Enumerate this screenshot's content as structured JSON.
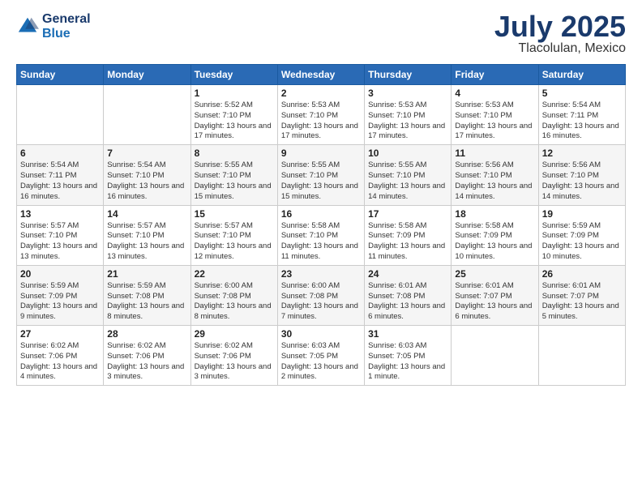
{
  "header": {
    "logo_general": "General",
    "logo_blue": "Blue",
    "month": "July 2025",
    "location": "Tlacolulan, Mexico"
  },
  "weekdays": [
    "Sunday",
    "Monday",
    "Tuesday",
    "Wednesday",
    "Thursday",
    "Friday",
    "Saturday"
  ],
  "weeks": [
    [
      {
        "day": "",
        "info": ""
      },
      {
        "day": "",
        "info": ""
      },
      {
        "day": "1",
        "info": "Sunrise: 5:52 AM\nSunset: 7:10 PM\nDaylight: 13 hours and 17 minutes."
      },
      {
        "day": "2",
        "info": "Sunrise: 5:53 AM\nSunset: 7:10 PM\nDaylight: 13 hours and 17 minutes."
      },
      {
        "day": "3",
        "info": "Sunrise: 5:53 AM\nSunset: 7:10 PM\nDaylight: 13 hours and 17 minutes."
      },
      {
        "day": "4",
        "info": "Sunrise: 5:53 AM\nSunset: 7:10 PM\nDaylight: 13 hours and 17 minutes."
      },
      {
        "day": "5",
        "info": "Sunrise: 5:54 AM\nSunset: 7:11 PM\nDaylight: 13 hours and 16 minutes."
      }
    ],
    [
      {
        "day": "6",
        "info": "Sunrise: 5:54 AM\nSunset: 7:11 PM\nDaylight: 13 hours and 16 minutes."
      },
      {
        "day": "7",
        "info": "Sunrise: 5:54 AM\nSunset: 7:10 PM\nDaylight: 13 hours and 16 minutes."
      },
      {
        "day": "8",
        "info": "Sunrise: 5:55 AM\nSunset: 7:10 PM\nDaylight: 13 hours and 15 minutes."
      },
      {
        "day": "9",
        "info": "Sunrise: 5:55 AM\nSunset: 7:10 PM\nDaylight: 13 hours and 15 minutes."
      },
      {
        "day": "10",
        "info": "Sunrise: 5:55 AM\nSunset: 7:10 PM\nDaylight: 13 hours and 14 minutes."
      },
      {
        "day": "11",
        "info": "Sunrise: 5:56 AM\nSunset: 7:10 PM\nDaylight: 13 hours and 14 minutes."
      },
      {
        "day": "12",
        "info": "Sunrise: 5:56 AM\nSunset: 7:10 PM\nDaylight: 13 hours and 14 minutes."
      }
    ],
    [
      {
        "day": "13",
        "info": "Sunrise: 5:57 AM\nSunset: 7:10 PM\nDaylight: 13 hours and 13 minutes."
      },
      {
        "day": "14",
        "info": "Sunrise: 5:57 AM\nSunset: 7:10 PM\nDaylight: 13 hours and 13 minutes."
      },
      {
        "day": "15",
        "info": "Sunrise: 5:57 AM\nSunset: 7:10 PM\nDaylight: 13 hours and 12 minutes."
      },
      {
        "day": "16",
        "info": "Sunrise: 5:58 AM\nSunset: 7:10 PM\nDaylight: 13 hours and 11 minutes."
      },
      {
        "day": "17",
        "info": "Sunrise: 5:58 AM\nSunset: 7:09 PM\nDaylight: 13 hours and 11 minutes."
      },
      {
        "day": "18",
        "info": "Sunrise: 5:58 AM\nSunset: 7:09 PM\nDaylight: 13 hours and 10 minutes."
      },
      {
        "day": "19",
        "info": "Sunrise: 5:59 AM\nSunset: 7:09 PM\nDaylight: 13 hours and 10 minutes."
      }
    ],
    [
      {
        "day": "20",
        "info": "Sunrise: 5:59 AM\nSunset: 7:09 PM\nDaylight: 13 hours and 9 minutes."
      },
      {
        "day": "21",
        "info": "Sunrise: 5:59 AM\nSunset: 7:08 PM\nDaylight: 13 hours and 8 minutes."
      },
      {
        "day": "22",
        "info": "Sunrise: 6:00 AM\nSunset: 7:08 PM\nDaylight: 13 hours and 8 minutes."
      },
      {
        "day": "23",
        "info": "Sunrise: 6:00 AM\nSunset: 7:08 PM\nDaylight: 13 hours and 7 minutes."
      },
      {
        "day": "24",
        "info": "Sunrise: 6:01 AM\nSunset: 7:08 PM\nDaylight: 13 hours and 6 minutes."
      },
      {
        "day": "25",
        "info": "Sunrise: 6:01 AM\nSunset: 7:07 PM\nDaylight: 13 hours and 6 minutes."
      },
      {
        "day": "26",
        "info": "Sunrise: 6:01 AM\nSunset: 7:07 PM\nDaylight: 13 hours and 5 minutes."
      }
    ],
    [
      {
        "day": "27",
        "info": "Sunrise: 6:02 AM\nSunset: 7:06 PM\nDaylight: 13 hours and 4 minutes."
      },
      {
        "day": "28",
        "info": "Sunrise: 6:02 AM\nSunset: 7:06 PM\nDaylight: 13 hours and 3 minutes."
      },
      {
        "day": "29",
        "info": "Sunrise: 6:02 AM\nSunset: 7:06 PM\nDaylight: 13 hours and 3 minutes."
      },
      {
        "day": "30",
        "info": "Sunrise: 6:03 AM\nSunset: 7:05 PM\nDaylight: 13 hours and 2 minutes."
      },
      {
        "day": "31",
        "info": "Sunrise: 6:03 AM\nSunset: 7:05 PM\nDaylight: 13 hours and 1 minute."
      },
      {
        "day": "",
        "info": ""
      },
      {
        "day": "",
        "info": ""
      }
    ]
  ]
}
